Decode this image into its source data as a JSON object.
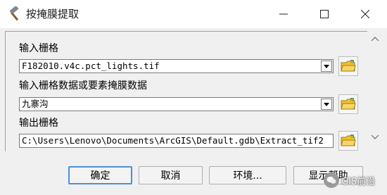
{
  "window": {
    "title": "按掩膜提取",
    "icon": "hammer-icon"
  },
  "fields": [
    {
      "label": "输入栅格",
      "value": "F182010.v4c.pct_lights.tif"
    },
    {
      "label": "输入栅格数据或要素掩膜数据",
      "value": "九寨沟"
    },
    {
      "label": "输出栅格",
      "value": "C:\\Users\\Lenovo\\Documents\\ArcGIS\\Default.gdb\\Extract_tif2"
    }
  ],
  "buttons": {
    "ok": "确定",
    "cancel": "取消",
    "environments": "环境...",
    "show_help": "显示帮助"
  },
  "watermark": "GIS前沿",
  "colors": {
    "accent_border": "#4c8fd6",
    "folder_yellow": "#f2c230"
  }
}
